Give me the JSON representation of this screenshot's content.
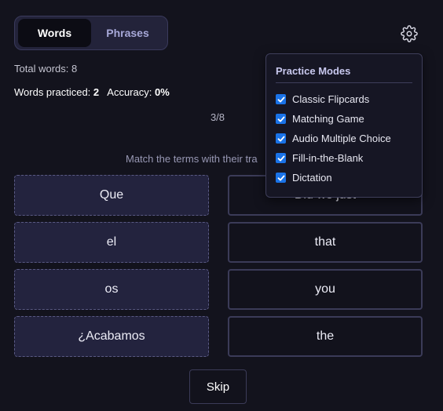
{
  "tabs": [
    {
      "label": "Words",
      "active": true
    },
    {
      "label": "Phrases",
      "active": false
    }
  ],
  "stats": {
    "total_label": "Total words:",
    "total_value": "8",
    "practiced_label": "Words practiced:",
    "practiced_value": "2",
    "accuracy_label": "Accuracy:",
    "accuracy_value": "0%"
  },
  "progress": "3/8",
  "instruction": "Match the terms with their tra",
  "terms": [
    "Que",
    "el",
    "os",
    "¿Acabamos"
  ],
  "definitions": [
    "Did we just",
    "that",
    "you",
    "the"
  ],
  "skip_label": "Skip",
  "practice_modes": {
    "title": "Practice Modes",
    "items": [
      {
        "label": "Classic Flipcards",
        "checked": true
      },
      {
        "label": "Matching Game",
        "checked": true
      },
      {
        "label": "Audio Multiple Choice",
        "checked": true
      },
      {
        "label": "Fill-in-the-Blank",
        "checked": true
      },
      {
        "label": "Dictation",
        "checked": true
      }
    ]
  },
  "colors": {
    "background": "#13131d",
    "accent": "#1a73e8",
    "tab_text": "#a7a8d8"
  },
  "icons": {
    "settings": "gear-icon",
    "checkbox": "check-icon"
  }
}
